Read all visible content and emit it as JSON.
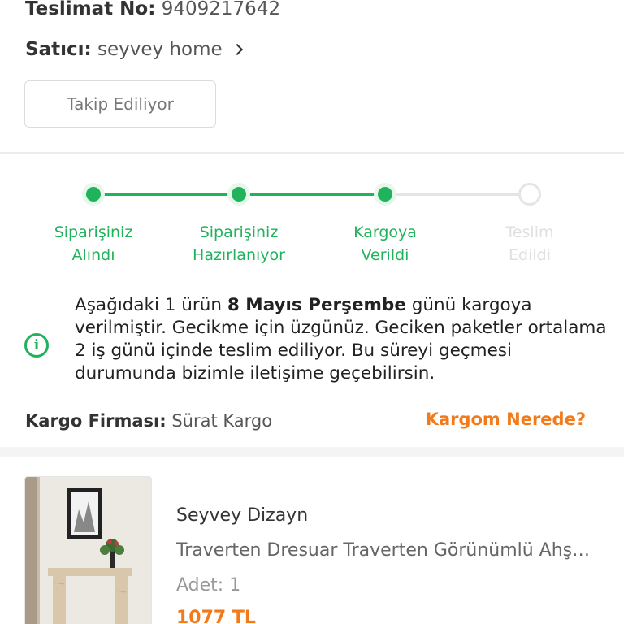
{
  "delivery": {
    "label": "Teslimat No:",
    "value": "9409217642"
  },
  "seller": {
    "label": "Satıcı:",
    "value": "seyvey home"
  },
  "follow_button": "Takip Ediliyor",
  "tracker": {
    "steps": [
      {
        "line1": "Siparişiniz",
        "line2": "Alındı",
        "status": "done"
      },
      {
        "line1": "Siparişiniz",
        "line2": "Hazırlanıyor",
        "status": "done"
      },
      {
        "line1": "Kargoya",
        "line2": "Verildi",
        "status": "done"
      },
      {
        "line1": "Teslim",
        "line2": "Edildi",
        "status": "pending"
      }
    ],
    "progress_fraction": 0.667
  },
  "info": {
    "part1": "Aşağıdaki 1 ürün ",
    "bold": "8 Mayıs Perşembe",
    "part2": " günü kargoya verilmiştir. Gecikme için üzgünüz. Geciken paketler ortalama 2 iş günü içinde teslim ediliyor. Bu süreyi geçmesi durumunda bizimle iletişime geçebilirsin."
  },
  "cargo": {
    "label": "Kargo Firması:",
    "value": "Sürat Kargo",
    "link": "Kargom Nerede?"
  },
  "product": {
    "brand": "Seyvey Dizayn",
    "name": "Traverten Dresuar Traverten Görünümlü Ahşap",
    "qty_label": "Adet:",
    "qty_value": "1",
    "price": "1077 TL"
  },
  "colors": {
    "green": "#21b35c",
    "orange": "#f27a1a",
    "inactive": "#e5e5e5"
  }
}
